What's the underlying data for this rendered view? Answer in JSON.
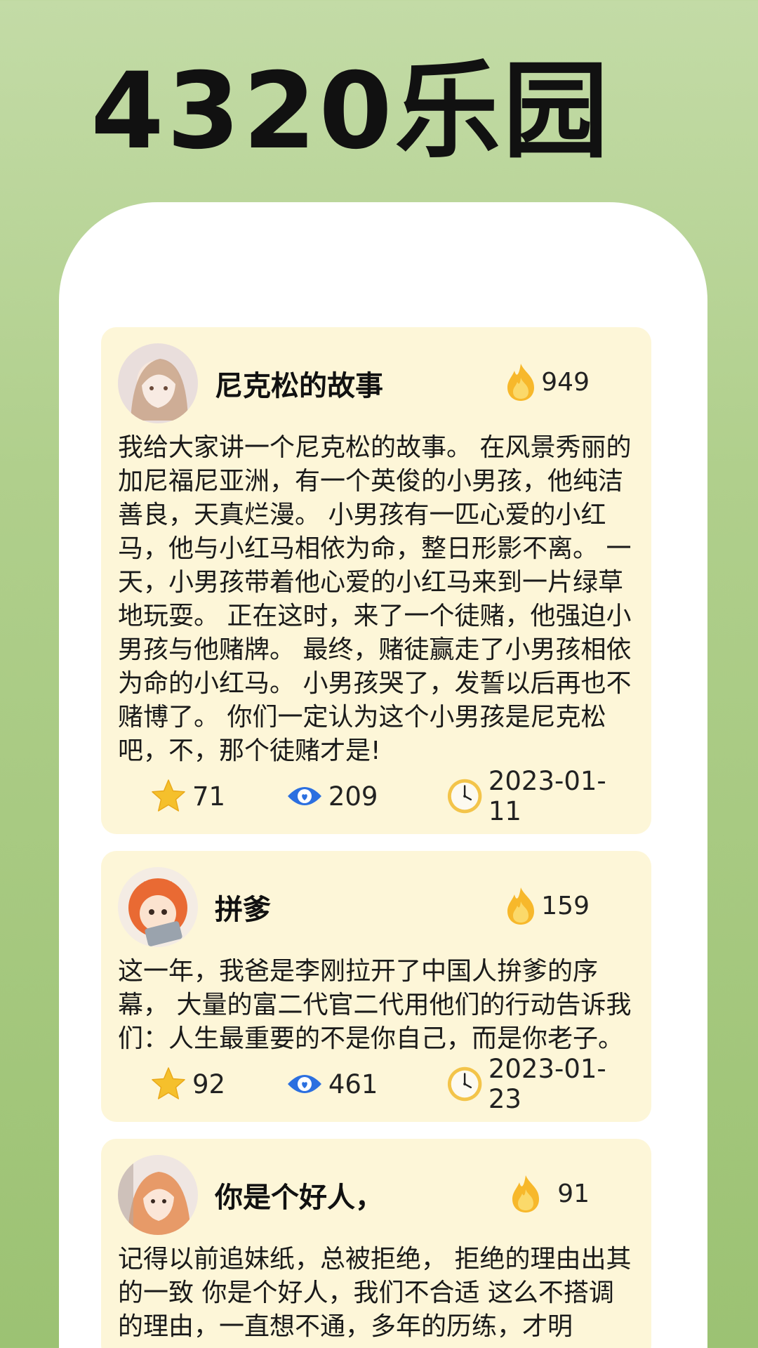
{
  "app": {
    "title": "4320乐园"
  },
  "posts": [
    {
      "title": "尼克松的故事",
      "hot": "949",
      "body": "我给大家讲一个尼克松的故事。 在风景秀丽的加尼福尼亚洲，有一个英俊的小男孩，他纯洁善良，天真烂漫。 小男孩有一匹心爱的小红马，他与小红马相依为命，整日形影不离。 一天，小男孩带着他心爱的小红马来到一片绿草地玩耍。 正在这时，来了一个徒赌，他强迫小男孩与他赌牌。 最终，赌徒赢走了小男孩相依为命的小红马。 小男孩哭了，发誓以后再也不赌博了。 你们一定认为这个小男孩是尼克松吧，不，那个徒赌才是!",
      "stars": "71",
      "views": "209",
      "date": "2023-01-11"
    },
    {
      "title": "拼爹",
      "hot": "159",
      "body": "这一年，我爸是李刚拉开了中国人拚爹的序幕， 大量的富二代官二代用他们的行动告诉我们：人生最重要的不是你自己，而是你老子。",
      "stars": "92",
      "views": "461",
      "date": "2023-01-23"
    },
    {
      "title": "你是个好人，",
      "hot": "91",
      "body": "记得以前追妹纸，总被拒绝， 拒绝的理由出其的一致 你是个好人，我们不合适 这么不搭调的理由，一直想不通，多年的历练，才明"
    }
  ],
  "icons": {
    "hot": "flame-icon",
    "star": "star-icon",
    "view": "eye-icon",
    "date": "clock-icon"
  },
  "colors": {
    "card": "#fdf6d8",
    "star": "#f5c02c",
    "eye": "#2b6fe0",
    "flame": "#f7b82b"
  }
}
